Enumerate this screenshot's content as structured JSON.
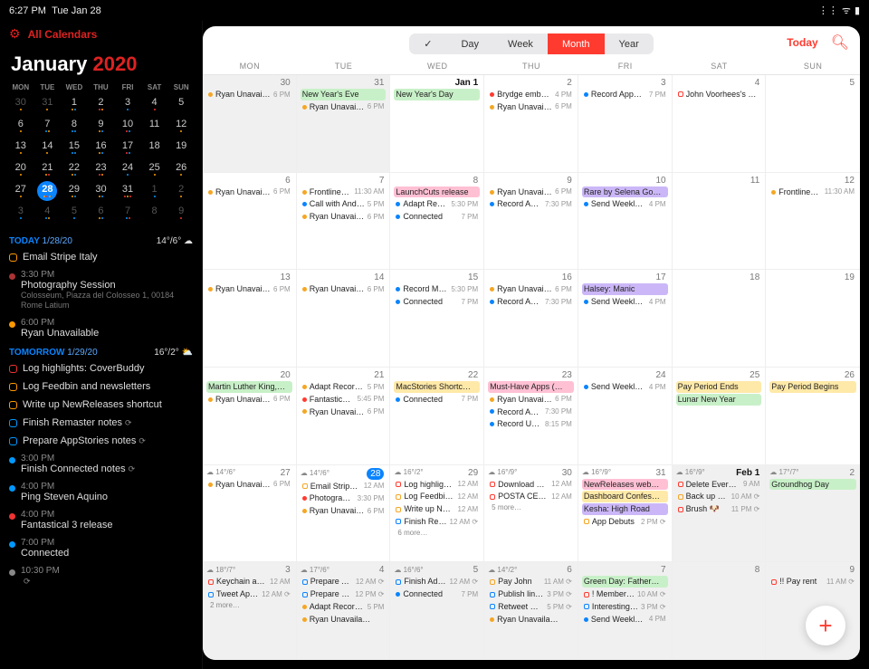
{
  "status": {
    "time": "6:27 PM",
    "date": "Tue Jan 28",
    "wifi": "wifi",
    "battery": "battery"
  },
  "sidebar": {
    "all_calendars": "All Calendars",
    "month": "January",
    "year": "2020",
    "dow": [
      "MON",
      "TUE",
      "WED",
      "THU",
      "FRI",
      "SAT",
      "SUN"
    ],
    "today_label": "TODAY",
    "today_date": "1/28/20",
    "today_wx": "14°/6°",
    "tomorrow_label": "TOMORROW",
    "tomorrow_date": "1/29/20",
    "tomorrow_wx": "16°/2°",
    "minical": [
      [
        {
          "n": "30",
          "dim": true,
          "dots": [
            "#f90"
          ]
        },
        {
          "n": "31",
          "dim": true,
          "dots": [
            "#f90"
          ]
        },
        {
          "n": "1",
          "dots": [
            "#f90",
            "#09f"
          ]
        },
        {
          "n": "2",
          "dots": [
            "#e33",
            "#f90"
          ]
        },
        {
          "n": "3",
          "dots": [
            "#09f"
          ]
        },
        {
          "n": "4",
          "dots": [
            "#e33"
          ]
        },
        {
          "n": "5",
          "dots": []
        }
      ],
      [
        {
          "n": "6",
          "dots": [
            "#f90"
          ]
        },
        {
          "n": "7",
          "dots": [
            "#09f",
            "#f90"
          ]
        },
        {
          "n": "8",
          "dots": [
            "#09f",
            "#09f"
          ]
        },
        {
          "n": "9",
          "dots": [
            "#f90",
            "#09f"
          ]
        },
        {
          "n": "10",
          "dots": [
            "#e33",
            "#09f"
          ]
        },
        {
          "n": "11",
          "dots": []
        },
        {
          "n": "12",
          "dots": [
            "#f90"
          ]
        }
      ],
      [
        {
          "n": "13",
          "dots": [
            "#f90"
          ]
        },
        {
          "n": "14",
          "dots": [
            "#f90"
          ]
        },
        {
          "n": "15",
          "dots": [
            "#09f",
            "#09f"
          ]
        },
        {
          "n": "16",
          "dots": [
            "#f90",
            "#09f"
          ]
        },
        {
          "n": "17",
          "dots": [
            "#e33",
            "#09f"
          ]
        },
        {
          "n": "18",
          "dots": []
        },
        {
          "n": "19",
          "dots": []
        }
      ],
      [
        {
          "n": "20",
          "dots": [
            "#f90"
          ]
        },
        {
          "n": "21",
          "dots": [
            "#f90",
            "#e33"
          ]
        },
        {
          "n": "22",
          "dots": [
            "#f90",
            "#09f"
          ]
        },
        {
          "n": "23",
          "dots": [
            "#e33",
            "#f90"
          ]
        },
        {
          "n": "24",
          "dots": [
            "#09f"
          ]
        },
        {
          "n": "25",
          "dots": [
            "#f90"
          ]
        },
        {
          "n": "26",
          "dots": [
            "#f90"
          ]
        }
      ],
      [
        {
          "n": "27",
          "dots": [
            "#f90"
          ]
        },
        {
          "n": "28",
          "today": true,
          "dots": [
            "#f90",
            "#e33",
            "#f90"
          ]
        },
        {
          "n": "29",
          "dots": [
            "#f90",
            "#09f"
          ]
        },
        {
          "n": "30",
          "dots": [
            "#f90",
            "#09f"
          ]
        },
        {
          "n": "31",
          "dots": [
            "#e33",
            "#f90",
            "#e33"
          ]
        },
        {
          "n": "1",
          "dim": true,
          "dots": [
            "#09f"
          ]
        },
        {
          "n": "2",
          "dim": true,
          "dots": [
            "#f90"
          ]
        }
      ],
      [
        {
          "n": "3",
          "dim": true,
          "dots": [
            "#09f"
          ]
        },
        {
          "n": "4",
          "dim": true,
          "dots": [
            "#09f",
            "#f90"
          ]
        },
        {
          "n": "5",
          "dim": true,
          "dots": [
            "#09f"
          ]
        },
        {
          "n": "6",
          "dim": true,
          "dots": [
            "#f90",
            "#09f"
          ]
        },
        {
          "n": "7",
          "dim": true,
          "dots": [
            "#09f",
            "#e33"
          ]
        },
        {
          "n": "8",
          "dim": true,
          "dots": []
        },
        {
          "n": "9",
          "dim": true,
          "dots": [
            "#e33"
          ]
        }
      ]
    ],
    "today_events": [
      {
        "c": "#f90",
        "t": "Email Stripe Italy",
        "type": "box"
      },
      {
        "c": "#a33",
        "t": "Photography Session",
        "time": "3:30 PM",
        "sub": "Colosseum, Piazza del Colosseo 1, 00184 Rome Latium",
        "type": "dot"
      },
      {
        "c": "#f90",
        "t": "Ryan Unavailable",
        "time": "6:00 PM",
        "type": "dot"
      }
    ],
    "tomorrow_events": [
      {
        "c": "#e33",
        "t": "Log highlights: CoverBuddy",
        "type": "box"
      },
      {
        "c": "#f90",
        "t": "Log Feedbin and newsletters",
        "type": "box"
      },
      {
        "c": "#f90",
        "t": "Write up NewReleases shortcut",
        "type": "box"
      },
      {
        "c": "#09f",
        "t": "Finish Remaster notes",
        "type": "box",
        "r": true
      },
      {
        "c": "#09f",
        "t": "Prepare AppStories notes",
        "type": "box",
        "r": true
      },
      {
        "c": "#09f",
        "t": "Finish Connected notes",
        "time": "3:00 PM",
        "type": "dot",
        "r": true
      },
      {
        "c": "#09f",
        "t": "Ping Steven Aquino",
        "time": "4:00 PM",
        "type": "dot"
      },
      {
        "c": "#e33",
        "t": "Fantastical 3 release",
        "time": "4:00 PM",
        "type": "dot"
      },
      {
        "c": "#09f",
        "t": "Connected",
        "time": "7:00 PM",
        "type": "dot"
      },
      {
        "c": "#888",
        "t": "",
        "time": "10:30 PM",
        "type": "dot",
        "r": true
      }
    ]
  },
  "toolbar": {
    "check": "✓",
    "views": [
      "Day",
      "Week",
      "Month",
      "Year"
    ],
    "active": "Month",
    "today": "Today"
  },
  "dow": [
    "MON",
    "TUE",
    "WED",
    "THU",
    "FRI",
    "SAT",
    "SUN"
  ],
  "colors": {
    "orange": "#f5a623",
    "blue": "#0a84ff",
    "red": "#ff3b30",
    "teal": "#00b8a9",
    "green": "#34c759",
    "pink": "#ffc0d4",
    "purple": "#cbb7f7",
    "yellow": "#ffe9a8",
    "ltgreen": "#c8f0c8",
    "ltblue": "#cfe8ff",
    "gray": "#888"
  },
  "weeks": [
    [
      {
        "d": "30",
        "dim": true,
        "ev": [
          {
            "c": "orange",
            "t": "Ryan Unavailable",
            "tm": "6 PM"
          }
        ]
      },
      {
        "d": "31",
        "dim": true,
        "ev": [
          {
            "bg": "ltgreen",
            "t": "New Year's Eve"
          },
          {
            "c": "orange",
            "t": "Ryan Unavaila…",
            "tm": "6 PM"
          }
        ]
      },
      {
        "d": "Jan 1",
        "first": true,
        "ev": [
          {
            "bg": "ltgreen",
            "t": "New Year's Day"
          }
        ]
      },
      {
        "d": "2",
        "ev": [
          {
            "c": "red",
            "t": "Brydge embar…",
            "tm": "4 PM"
          },
          {
            "c": "orange",
            "t": "Ryan Unavaila…",
            "tm": "6 PM"
          }
        ]
      },
      {
        "d": "3",
        "ev": [
          {
            "c": "blue",
            "t": "Record AppSt…",
            "tm": "7 PM"
          }
        ]
      },
      {
        "d": "4",
        "ev": [
          {
            "c": "red",
            "box": true,
            "t": "John Voorhees's 54…"
          }
        ]
      },
      {
        "d": "5",
        "ev": []
      }
    ],
    [
      {
        "d": "6",
        "ev": [
          {
            "c": "orange",
            "t": "Ryan Unavailable",
            "tm": "6 PM"
          }
        ]
      },
      {
        "d": "7",
        "ev": [
          {
            "c": "orange",
            "t": "Frontline…",
            "tm": "11:30 AM"
          },
          {
            "c": "blue",
            "t": "Call with Andr…",
            "tm": "5 PM"
          },
          {
            "c": "orange",
            "t": "Ryan Unavaila…",
            "tm": "6 PM"
          }
        ]
      },
      {
        "d": "8",
        "ev": [
          {
            "bg": "pink",
            "t": "LaunchCuts release"
          },
          {
            "c": "blue",
            "t": "Adapt Rec…",
            "tm": "5:30 PM"
          },
          {
            "c": "blue",
            "t": "Connected",
            "tm": "7 PM"
          }
        ]
      },
      {
        "d": "9",
        "ev": [
          {
            "c": "orange",
            "t": "Ryan Unavaila…",
            "tm": "6 PM"
          },
          {
            "c": "blue",
            "t": "Record Ap…",
            "tm": "7:30 PM"
          }
        ]
      },
      {
        "d": "10",
        "ev": [
          {
            "bg": "purple",
            "t": "Rare by Selena Go…"
          },
          {
            "c": "blue",
            "t": "Send Weekly I…",
            "tm": "4 PM"
          }
        ]
      },
      {
        "d": "11",
        "ev": []
      },
      {
        "d": "12",
        "ev": [
          {
            "c": "orange",
            "t": "Frontline…",
            "tm": "11:30 AM"
          }
        ]
      }
    ],
    [
      {
        "d": "13",
        "ev": [
          {
            "c": "orange",
            "t": "Ryan Unavailable",
            "tm": "6 PM"
          }
        ]
      },
      {
        "d": "14",
        "ev": [
          {
            "c": "orange",
            "t": "Ryan Unavailable",
            "tm": "6 PM"
          }
        ]
      },
      {
        "d": "15",
        "ev": [
          {
            "c": "blue",
            "t": "Record Ma…",
            "tm": "5:30 PM"
          },
          {
            "c": "blue",
            "t": "Connected",
            "tm": "7 PM"
          }
        ]
      },
      {
        "d": "16",
        "ev": [
          {
            "c": "orange",
            "t": "Ryan Unavaila…",
            "tm": "6 PM"
          },
          {
            "c": "blue",
            "t": "Record Ap…",
            "tm": "7:30 PM"
          }
        ]
      },
      {
        "d": "17",
        "ev": [
          {
            "bg": "purple",
            "t": "Halsey: Manic"
          },
          {
            "c": "blue",
            "t": "Send Weekly I…",
            "tm": "4 PM"
          }
        ]
      },
      {
        "d": "18",
        "ev": []
      },
      {
        "d": "19",
        "ev": []
      }
    ],
    [
      {
        "d": "20",
        "ev": [
          {
            "bg": "ltgreen",
            "t": "Martin Luther King,…"
          },
          {
            "c": "orange",
            "t": "Ryan Unavailable",
            "tm": "6 PM"
          }
        ]
      },
      {
        "d": "21",
        "ev": [
          {
            "c": "orange",
            "t": "Adapt Recordi…",
            "tm": "5 PM"
          },
          {
            "c": "red",
            "t": "Fantastical…",
            "tm": "5:45 PM"
          },
          {
            "c": "orange",
            "t": "Ryan Unavaila…",
            "tm": "6 PM"
          }
        ]
      },
      {
        "d": "22",
        "ev": [
          {
            "bg": "yellow",
            "t": "MacStories Shortc…"
          },
          {
            "c": "blue",
            "t": "Connected",
            "tm": "7 PM"
          }
        ]
      },
      {
        "d": "23",
        "ev": [
          {
            "bg": "pink",
            "t": "Must-Have Apps (…"
          },
          {
            "c": "orange",
            "t": "Ryan Unavaila…",
            "tm": "6 PM"
          },
          {
            "c": "blue",
            "t": "Record Ap…",
            "tm": "7:30 PM"
          },
          {
            "c": "blue",
            "t": "Record Un…",
            "tm": "8:15 PM"
          }
        ]
      },
      {
        "d": "24",
        "ev": [
          {
            "c": "blue",
            "t": "Send Weekly I…",
            "tm": "4 PM"
          }
        ]
      },
      {
        "d": "25",
        "ev": [
          {
            "bg": "yellow",
            "t": "Pay Period Ends"
          },
          {
            "bg": "ltgreen",
            "t": "Lunar New Year"
          }
        ]
      },
      {
        "d": "26",
        "ev": [
          {
            "bg": "yellow",
            "t": "Pay Period Begins"
          }
        ]
      }
    ],
    [
      {
        "d": "27",
        "wx": "14°/6°",
        "ev": [
          {
            "c": "orange",
            "t": "Ryan Unavailable",
            "tm": "6 PM"
          }
        ]
      },
      {
        "d": "28",
        "today": true,
        "wx": "14°/6°",
        "ev": [
          {
            "c": "orange",
            "box": true,
            "t": "Email Stripe I…",
            "tm": "12 AM"
          },
          {
            "c": "red",
            "t": "Photograp…",
            "tm": "3:30 PM"
          },
          {
            "c": "orange",
            "t": "Ryan Unavaila…",
            "tm": "6 PM"
          }
        ]
      },
      {
        "d": "29",
        "wx": "16°/2°",
        "ev": [
          {
            "c": "red",
            "box": true,
            "t": "Log highlight…",
            "tm": "12 AM"
          },
          {
            "c": "orange",
            "box": true,
            "t": "Log Feedbin…",
            "tm": "12 AM"
          },
          {
            "c": "orange",
            "box": true,
            "t": "Write up Ne…",
            "tm": "12 AM"
          },
          {
            "c": "blue",
            "box": true,
            "t": "Finish Rem…",
            "tm": "12 AM",
            "r": true
          }
        ],
        "more": "6 more…"
      },
      {
        "d": "30",
        "wx": "16°/9°",
        "ev": [
          {
            "c": "red",
            "box": true,
            "t": "Download Yo…",
            "tm": "12 AM"
          },
          {
            "c": "red",
            "box": true,
            "t": "POSTA CERT…",
            "tm": "12 AM"
          }
        ],
        "more": "5 more…"
      },
      {
        "d": "31",
        "wx": "16°/9°",
        "ev": [
          {
            "bg": "pink",
            "t": "NewReleases web…"
          },
          {
            "bg": "yellow",
            "t": "Dashboard Confes…"
          },
          {
            "bg": "purple",
            "t": "Kesha: High Road"
          },
          {
            "c": "orange",
            "box": true,
            "t": "App Debuts",
            "tm": "2 PM",
            "r": true
          }
        ]
      },
      {
        "d": "Feb 1",
        "dim": true,
        "first": true,
        "wx": "16°/9°",
        "ev": [
          {
            "c": "red",
            "box": true,
            "t": "Delete Everno…",
            "tm": "9 AM"
          },
          {
            "c": "orange",
            "box": true,
            "t": "Back up ph…",
            "tm": "10 AM",
            "r": true
          },
          {
            "c": "red",
            "box": true,
            "t": "Brush 🐶",
            "tm": "11 PM",
            "r": true
          }
        ]
      },
      {
        "d": "2",
        "dim": true,
        "wx": "17°/7°",
        "ev": [
          {
            "bg": "ltgreen",
            "t": "Groundhog Day"
          }
        ]
      }
    ],
    [
      {
        "d": "3",
        "dim": true,
        "wx": "18°/7°",
        "ev": [
          {
            "c": "red",
            "box": true,
            "t": "Keychain app…",
            "tm": "12 AM"
          },
          {
            "c": "blue",
            "box": true,
            "t": "Tweet AppS…",
            "tm": "12 AM",
            "r": true
          }
        ],
        "more": "2 more…"
      },
      {
        "d": "4",
        "dim": true,
        "wx": "17°/6°",
        "ev": [
          {
            "c": "blue",
            "box": true,
            "t": "Prepare Ad…",
            "tm": "12 AM",
            "r": true
          },
          {
            "c": "blue",
            "box": true,
            "t": "Prepare Co…",
            "tm": "12 PM",
            "r": true
          },
          {
            "c": "orange",
            "t": "Adapt Recordi…",
            "tm": "5 PM"
          },
          {
            "c": "orange",
            "t": "Ryan Unavaila…",
            "tm": ""
          }
        ]
      },
      {
        "d": "5",
        "dim": true,
        "wx": "16°/6°",
        "ev": [
          {
            "c": "blue",
            "box": true,
            "t": "Finish Ada…",
            "tm": "12 AM",
            "r": true
          },
          {
            "c": "blue",
            "t": "Connected",
            "tm": "7 PM"
          }
        ]
      },
      {
        "d": "6",
        "dim": true,
        "wx": "14°/2°",
        "ev": [
          {
            "c": "orange",
            "box": true,
            "t": "Pay John",
            "tm": "11 AM",
            "r": true
          },
          {
            "c": "blue",
            "box": true,
            "t": "Publish link…",
            "tm": "3 PM",
            "r": true
          },
          {
            "c": "blue",
            "box": true,
            "t": "Retweet Ma…",
            "tm": "5 PM",
            "r": true
          },
          {
            "c": "orange",
            "t": "Ryan Unavaila…",
            "tm": ""
          }
        ]
      },
      {
        "d": "7",
        "dim": true,
        "ev": [
          {
            "bg": "ltgreen",
            "t": "Green Day: Father…"
          },
          {
            "c": "red",
            "box": true,
            "t": "! Memberf…",
            "tm": "10 AM",
            "r": true
          },
          {
            "c": "blue",
            "box": true,
            "t": "Interesting…",
            "tm": "3 PM",
            "r": true
          },
          {
            "c": "blue",
            "t": "Send Weekly I…",
            "tm": "4 PM"
          }
        ]
      },
      {
        "d": "8",
        "dim": true,
        "ev": []
      },
      {
        "d": "9",
        "dim": true,
        "ev": [
          {
            "c": "red",
            "box": true,
            "t": "!! Pay rent",
            "tm": "11 AM",
            "r": true
          }
        ]
      }
    ]
  ]
}
